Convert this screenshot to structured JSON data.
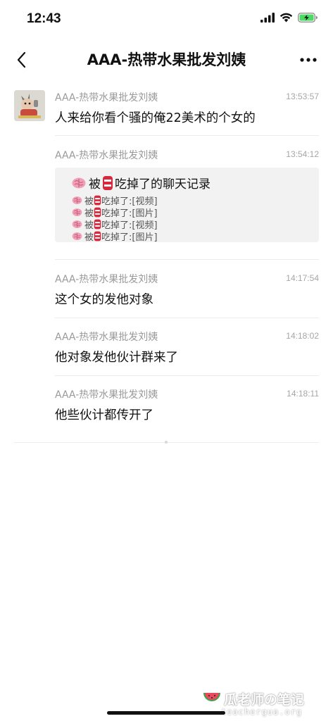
{
  "status": {
    "time": "12:43",
    "battery_color": "#4cd964"
  },
  "nav": {
    "title": "AAA-热带水果批发刘姨"
  },
  "messages": [
    {
      "sender": "AAA-热带水果批发刘姨",
      "time": "13:53:57",
      "text": "人来给你看个骚的俺22美术的个女的"
    },
    {
      "sender": "AAA-热带水果批发刘姨",
      "time": "13:54:12",
      "record": {
        "title": "被 吃掉了的聊天记录",
        "prefix": "被",
        "lines": [
          "吃掉了:[视频]",
          "吃掉了:[图片]",
          "吃掉了:[视频]",
          "吃掉了:[图片]"
        ]
      }
    },
    {
      "sender": "AAA-热带水果批发刘姨",
      "time": "14:17:54",
      "text": "这个女的发他对象"
    },
    {
      "sender": "AAA-热带水果批发刘姨",
      "time": "14:18:02",
      "text": "他对象发他伙计群来了"
    },
    {
      "sender": "AAA-热带水果批发刘姨",
      "time": "14:18:11",
      "text": "他些伙计都传开了"
    }
  ],
  "watermark": {
    "name": "瓜老师の笔记",
    "url": "teachergua.org"
  }
}
